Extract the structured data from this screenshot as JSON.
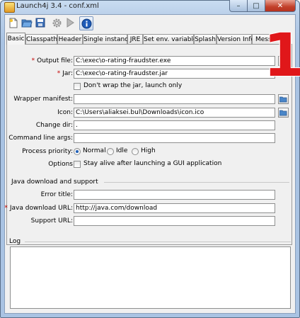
{
  "window": {
    "title": "Launch4j 3.4 - conf.xml",
    "minimize": "–",
    "maximize": "□",
    "close": "✕"
  },
  "toolbar": {
    "icons": [
      "new-document-icon",
      "open-folder-icon",
      "save-icon",
      "settings-gear-icon",
      "run-play-icon",
      "info-icon"
    ],
    "selected": "info-icon"
  },
  "tabs": [
    "Basic",
    "Classpath",
    "Header",
    "Single instance",
    "JRE",
    "Set env. variables",
    "Splash",
    "Version Info",
    "Messa"
  ],
  "active_tab": "Basic",
  "basic": {
    "output_file": {
      "label": "Output file:",
      "value": "C:\\exec\\o-rating-fraudster.exe",
      "required": true
    },
    "jar": {
      "label": "Jar:",
      "value": "C:\\exec\\o-rating-fraudster.jar",
      "required": true
    },
    "dont_wrap": {
      "label": "Don't wrap the jar, launch only",
      "checked": false
    },
    "wrapper_manifest": {
      "label": "Wrapper manifest:",
      "value": ""
    },
    "icon": {
      "label": "Icon:",
      "value": "C:\\Users\\aliaksei.bul\\Downloads\\icon.ico"
    },
    "change_dir": {
      "label": "Change dir:",
      "value": "."
    },
    "command_line_args": {
      "label": "Command line args:",
      "value": ""
    },
    "process_priority": {
      "label": "Process priority:",
      "options": [
        "Normal",
        "Idle",
        "High"
      ],
      "selected": "Normal"
    },
    "options": {
      "label": "Options",
      "stay_alive": "Stay alive after launching a GUI application",
      "checked": false
    }
  },
  "java_download": {
    "section_title": "Java download and support",
    "error_title": {
      "label": "Error title:",
      "value": ""
    },
    "download_url": {
      "label": "Java download URL:",
      "value": "http://java.com/download",
      "required": true
    },
    "support_url": {
      "label": "Support URL:",
      "value": ""
    }
  },
  "log": {
    "title": "Log",
    "content": ""
  },
  "overlay": {
    "badge": "1",
    "color": "#e0171a"
  },
  "colors": {
    "required_star": "#c40000",
    "accent": "#1e5fb8"
  }
}
